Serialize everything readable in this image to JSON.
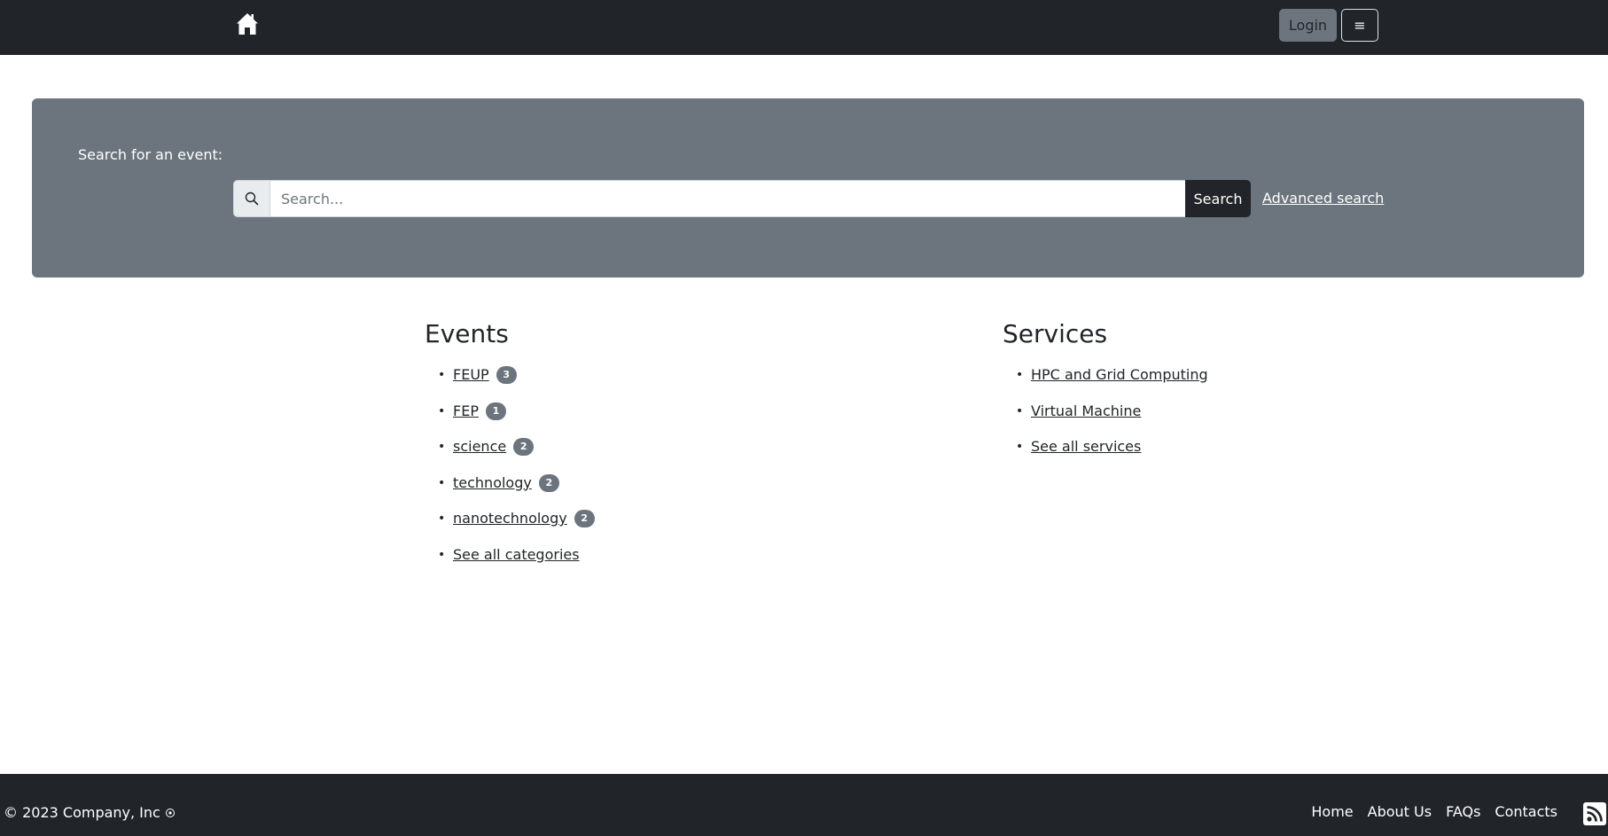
{
  "header": {
    "home_icon": "home-icon",
    "login_label": "Login",
    "menu_icon": "≡"
  },
  "search": {
    "heading": "Search for an event:",
    "icon": "search-icon",
    "placeholder": "Search...",
    "value": "",
    "button_label": "Search",
    "advanced_label": "Advanced search"
  },
  "events": {
    "title": "Events",
    "items": [
      {
        "label": "FEUP",
        "count": "3"
      },
      {
        "label": "FEP",
        "count": "1"
      },
      {
        "label": "science",
        "count": "2"
      },
      {
        "label": "technology",
        "count": "2"
      },
      {
        "label": "nanotechnology",
        "count": "2"
      },
      {
        "label": "See all categories"
      }
    ]
  },
  "services": {
    "title": "Services",
    "items": [
      {
        "label": "HPC and Grid Computing"
      },
      {
        "label": "Virtual Machine"
      },
      {
        "label": "See all services"
      }
    ]
  },
  "footer": {
    "copyright": "© 2023 Company, Inc",
    "links": [
      "Home",
      "About Us",
      "FAQs",
      "Contacts"
    ],
    "rss_icon": "rss-icon"
  },
  "colors": {
    "dark": "#212529",
    "secondary": "#6c757d",
    "light": "#e9ecef"
  }
}
